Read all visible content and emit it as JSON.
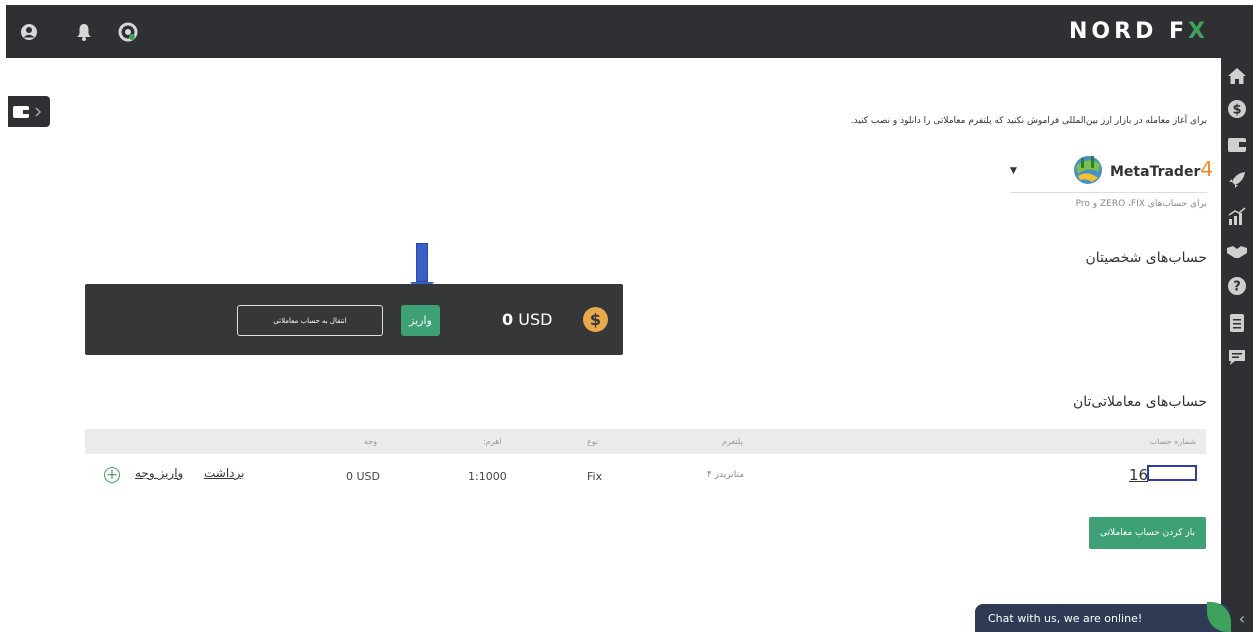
{
  "header": {
    "logo_main": "NORD F",
    "logo_x": "X",
    "icons": [
      "user-circle-icon",
      "bell-icon",
      "support-headset-icon"
    ]
  },
  "sidebar_right": {
    "icons": [
      "home-icon",
      "dollar-icon",
      "wallet-icon",
      "rocket-icon",
      "chart-growth-icon",
      "handshake-icon",
      "help-icon",
      "document-icon",
      "chat-icon"
    ]
  },
  "notice": "برای آغاز معامله در بازار ارز بین‌المللی فراموش نکنید که پلتفرم معاملاتی را دانلود و نصب کنید.",
  "platform": {
    "name": "MetaTrader",
    "version": "4",
    "subtitle": "برای حساب‌های ZERO ،FIX و Pro"
  },
  "personal": {
    "title": "حساب‌های شخصیتان",
    "transfer_label": "انتقال به حساب معاملاتی",
    "deposit_label": "واریز",
    "balance_amount": "0",
    "balance_currency": "USD",
    "coin_symbol": "$"
  },
  "trading": {
    "title": "حساب‌های معاملاتی‌تان",
    "columns": {
      "account_number": "شماره حساب",
      "platform": "پلتفرم",
      "type": "نوع",
      "leverage": "اهرم:",
      "funds": "وجه"
    },
    "row": {
      "account_number": "16",
      "platform": "متاتریدر ۴",
      "type": "Fix",
      "leverage": "1:1000",
      "funds": "0 USD",
      "deposit_link": "واریز وجه",
      "withdraw_link": "برداشت"
    },
    "open_account_label": "باز کردن حساب معاملاتی"
  },
  "chat": {
    "label": "Chat with us, we are online!"
  },
  "colors": {
    "dark_bar": "#2f3033",
    "accent_green": "#3ea176",
    "arrow_blue": "#3b5fc6",
    "coin": "#e8a94a"
  }
}
